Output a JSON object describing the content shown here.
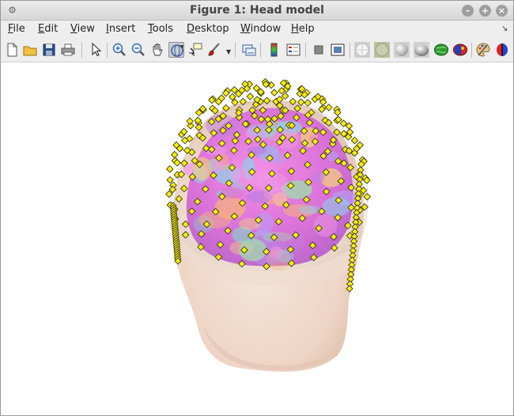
{
  "window": {
    "title": "Figure 1: Head model",
    "buttons": {
      "minimize": "–",
      "maximize": "+",
      "close": "×"
    }
  },
  "menubar": {
    "items": [
      {
        "key": "file",
        "label": "File",
        "u": "F",
        "rest": "ile"
      },
      {
        "key": "edit",
        "label": "Edit",
        "u": "E",
        "rest": "dit"
      },
      {
        "key": "view",
        "label": "View",
        "u": "V",
        "rest": "iew"
      },
      {
        "key": "insert",
        "label": "Insert",
        "u": "I",
        "rest": "nsert"
      },
      {
        "key": "tools",
        "label": "Tools",
        "u": "T",
        "rest": "ools"
      },
      {
        "key": "desktop",
        "label": "Desktop",
        "u": "D",
        "rest": "esktop"
      },
      {
        "key": "window",
        "label": "Window",
        "u": "W",
        "rest": "indow"
      },
      {
        "key": "help",
        "label": "Help",
        "u": "H",
        "rest": "elp"
      }
    ],
    "corner_arrow": "↘"
  },
  "toolbar": {
    "buttons": [
      "new-figure",
      "open-file",
      "save",
      "print",
      "edit-plot",
      "zoom-in",
      "zoom-out",
      "pan",
      "rotate-3d",
      "data-cursor",
      "brush",
      "link-plot",
      "colorbar",
      "legend",
      "hide-plot-tools",
      "show-plot-tools",
      "lighting-none",
      "lighting-flat",
      "lighting-gouraud",
      "lighting-phong",
      "brain-green",
      "brain-colored",
      "palette",
      "brain-red-blue"
    ],
    "pressed": "rotate-3d"
  },
  "colors": {
    "electrode": "#f5ea19",
    "electrode_edge": "#2a2a00",
    "scalp": "#f2dccd",
    "brain_pink": "#e873d6"
  }
}
